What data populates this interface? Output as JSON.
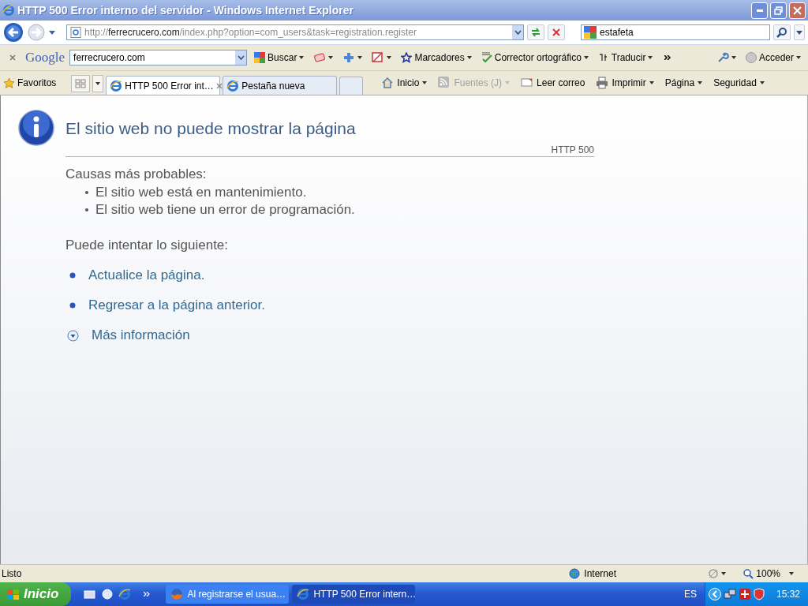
{
  "window": {
    "title": "HTTP 500 Error interno del servidor - Windows Internet Explorer"
  },
  "address_bar": {
    "scheme": "http://",
    "host": "ferrecrucero.com",
    "path": "/index.php?option=com_users&task=registration.register"
  },
  "search_box": {
    "value": "estafeta"
  },
  "google_toolbar": {
    "logo": "Google",
    "search_value": "ferrecrucero.com",
    "items": [
      {
        "kind": "search",
        "label": "Buscar"
      },
      {
        "kind": "bookmarks",
        "label": "Marcadores"
      },
      {
        "kind": "spellcheck",
        "label": "Corrector ortográfico"
      },
      {
        "kind": "translate",
        "label": "Traducir"
      },
      {
        "kind": "signin",
        "label": "Acceder"
      }
    ]
  },
  "favorites": {
    "label": "Favoritos"
  },
  "tabs": [
    {
      "label": "HTTP 500 Error int…",
      "selected": true
    },
    {
      "label": "Pestaña nueva",
      "selected": false
    }
  ],
  "command_bar": [
    {
      "kind": "home",
      "label": "Inicio",
      "disabled": false
    },
    {
      "kind": "feeds",
      "label": "Fuentes (J)",
      "disabled": true
    },
    {
      "kind": "mail",
      "label": "Leer correo",
      "disabled": false
    },
    {
      "kind": "print",
      "label": "Imprimir",
      "disabled": false
    },
    {
      "kind": "page",
      "label": "Página",
      "disabled": false
    },
    {
      "kind": "safety",
      "label": "Seguridad",
      "disabled": false
    }
  ],
  "page": {
    "title": "El sitio web no puede mostrar la página",
    "code": "HTTP 500",
    "causes_heading": "Causas más probables:",
    "causes": [
      "El sitio web está en mantenimiento.",
      "El sitio web tiene un error de programación."
    ],
    "try_heading": "Puede intentar lo siguiente:",
    "actions": [
      "Actualice la página.",
      "Regresar a la página anterior."
    ],
    "more_info": "Más información"
  },
  "status_bar": {
    "text": "Listo",
    "zone": "Internet",
    "zoom": "100%"
  },
  "taskbar": {
    "start": "Inicio",
    "tasks": [
      {
        "label": "Al registrarse el usua…",
        "kind": "firefox",
        "selected": false
      },
      {
        "label": "HTTP 500 Error intern…",
        "kind": "ie",
        "selected": true
      }
    ],
    "language": "ES",
    "clock": "15:32"
  }
}
